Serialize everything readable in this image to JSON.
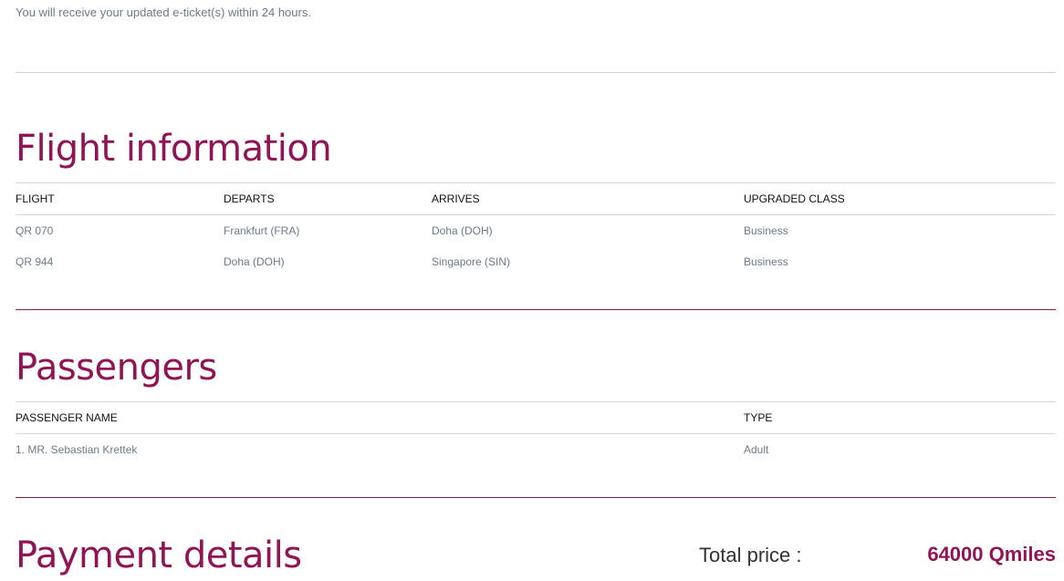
{
  "notice": "You will receive your updated e-ticket(s) within 24 hours.",
  "flight_section": {
    "title": "Flight information",
    "headers": {
      "flight": "FLIGHT",
      "departs": "DEPARTS",
      "arrives": "ARRIVES",
      "class": "UPGRADED CLASS"
    },
    "rows": [
      {
        "flight": "QR 070",
        "departs": "Frankfurt (FRA)",
        "arrives": "Doha (DOH)",
        "class": "Business"
      },
      {
        "flight": "QR 944",
        "departs": "Doha (DOH)",
        "arrives": "Singapore (SIN)",
        "class": "Business"
      }
    ]
  },
  "passengers_section": {
    "title": "Passengers",
    "headers": {
      "name": "PASSENGER NAME",
      "type": "TYPE"
    },
    "rows": [
      {
        "name": "1. MR. Sebastian Krettek",
        "type": "Adult"
      }
    ]
  },
  "payment_section": {
    "title": "Payment details",
    "total_label": "Total price :",
    "total_value": "64000 Qmiles"
  },
  "colors": {
    "accent": "#8f1555",
    "muted_text": "#6b7b88",
    "divider": "#7a1c4f"
  }
}
